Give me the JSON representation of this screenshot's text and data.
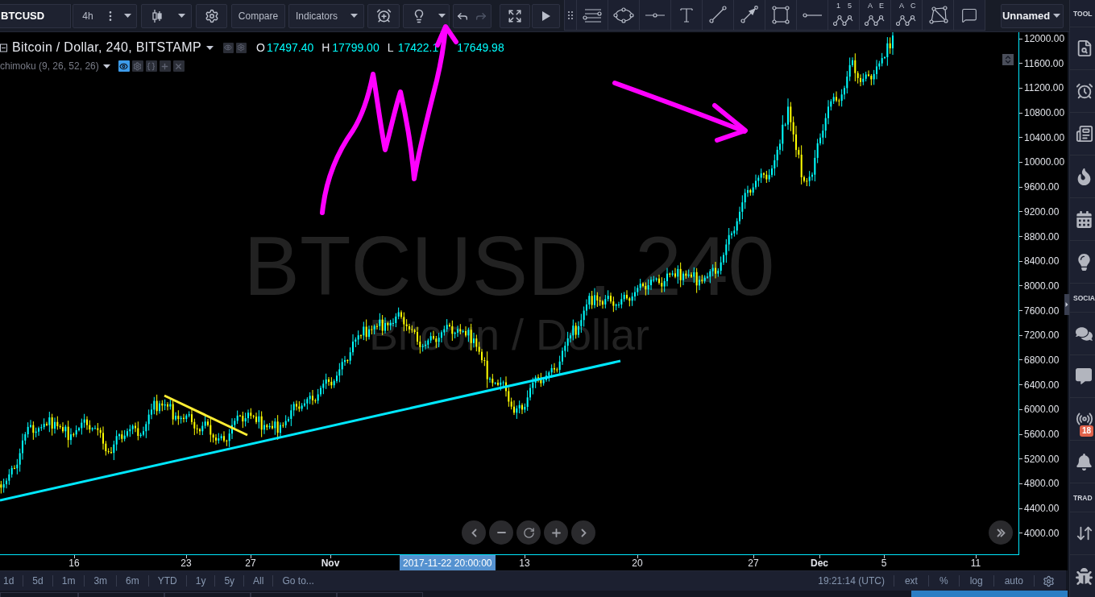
{
  "toolbar": {
    "symbol": "BTCUSD",
    "interval": "4h",
    "compare": "Compare",
    "indicators": "Indicators",
    "undo": {
      "disabled": false
    },
    "redo": {
      "disabled": true
    },
    "layout": "Unnamed"
  },
  "drawing_toolbar": {
    "pattern_tools": [
      {
        "labels": [
          "1",
          "5"
        ]
      },
      {
        "labels": [
          "A",
          "E"
        ]
      },
      {
        "labels": [
          "A",
          "C"
        ]
      }
    ]
  },
  "legend": {
    "title": "Bitcoin / Dollar, 240, BITSTAMP",
    "values": [
      {
        "label": "O",
        "value": "17497.40"
      },
      {
        "label": "H",
        "value": "17799.00"
      },
      {
        "label": "L",
        "value": "17422.1"
      },
      {
        "value": "17649.98"
      }
    ],
    "indicator": {
      "name": "chimoku (9, 26, 52, 26)",
      "visible": true
    }
  },
  "chart": {
    "watermark": {
      "symbol": "BTCUSD, 240",
      "description": "Bitcoin / Dollar"
    },
    "price_axis": [
      "12000.00",
      "11600.00",
      "11200.00",
      "10800.00",
      "10400.00",
      "10000.00",
      "9600.00",
      "9200.00",
      "8800.00",
      "8400.00",
      "8000.00",
      "7600.00",
      "7200.00",
      "6800.00",
      "6400.00",
      "6000.00",
      "5600.00",
      "5200.00",
      "4800.00",
      "4400.00",
      "4000.00"
    ],
    "time_axis": [
      {
        "label": "16",
        "kind": "day"
      },
      {
        "label": "23",
        "kind": "day"
      },
      {
        "label": "27",
        "kind": "day"
      },
      {
        "label": "Nov",
        "kind": "month"
      },
      {
        "label": "13",
        "kind": "day"
      },
      {
        "label": "20",
        "kind": "day"
      },
      {
        "label": "27",
        "kind": "day"
      },
      {
        "label": "Dec",
        "kind": "month"
      },
      {
        "label": "5",
        "kind": "day"
      },
      {
        "label": "11",
        "kind": "day"
      }
    ],
    "crosshair_time": "2017-11-22 20:00:00"
  },
  "bottom_bar": {
    "ranges": [
      "1d",
      "5d",
      "1m",
      "3m",
      "6m",
      "YTD",
      "1y",
      "5y",
      "All"
    ],
    "goto": "Go to...",
    "clock": "19:21:14 (UTC)",
    "options": [
      "ext",
      "%",
      "log",
      "auto"
    ]
  },
  "right_sidebar": {
    "header": "TOOL",
    "sections": [
      "SOCIA",
      "TRAD"
    ],
    "badge": "18"
  }
}
